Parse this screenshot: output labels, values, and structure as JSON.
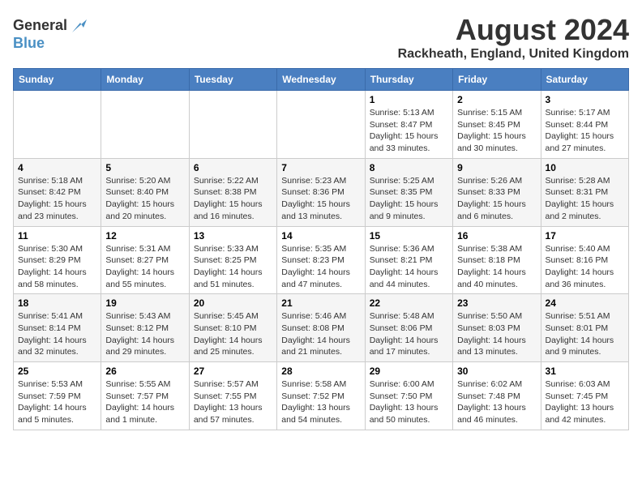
{
  "logo": {
    "line1": "General",
    "line2": "Blue"
  },
  "title": "August 2024",
  "subtitle": "Rackheath, England, United Kingdom",
  "days_header": [
    "Sunday",
    "Monday",
    "Tuesday",
    "Wednesday",
    "Thursday",
    "Friday",
    "Saturday"
  ],
  "weeks": [
    [
      {
        "day": "",
        "info": ""
      },
      {
        "day": "",
        "info": ""
      },
      {
        "day": "",
        "info": ""
      },
      {
        "day": "",
        "info": ""
      },
      {
        "day": "1",
        "info": "Sunrise: 5:13 AM\nSunset: 8:47 PM\nDaylight: 15 hours\nand 33 minutes."
      },
      {
        "day": "2",
        "info": "Sunrise: 5:15 AM\nSunset: 8:45 PM\nDaylight: 15 hours\nand 30 minutes."
      },
      {
        "day": "3",
        "info": "Sunrise: 5:17 AM\nSunset: 8:44 PM\nDaylight: 15 hours\nand 27 minutes."
      }
    ],
    [
      {
        "day": "4",
        "info": "Sunrise: 5:18 AM\nSunset: 8:42 PM\nDaylight: 15 hours\nand 23 minutes."
      },
      {
        "day": "5",
        "info": "Sunrise: 5:20 AM\nSunset: 8:40 PM\nDaylight: 15 hours\nand 20 minutes."
      },
      {
        "day": "6",
        "info": "Sunrise: 5:22 AM\nSunset: 8:38 PM\nDaylight: 15 hours\nand 16 minutes."
      },
      {
        "day": "7",
        "info": "Sunrise: 5:23 AM\nSunset: 8:36 PM\nDaylight: 15 hours\nand 13 minutes."
      },
      {
        "day": "8",
        "info": "Sunrise: 5:25 AM\nSunset: 8:35 PM\nDaylight: 15 hours\nand 9 minutes."
      },
      {
        "day": "9",
        "info": "Sunrise: 5:26 AM\nSunset: 8:33 PM\nDaylight: 15 hours\nand 6 minutes."
      },
      {
        "day": "10",
        "info": "Sunrise: 5:28 AM\nSunset: 8:31 PM\nDaylight: 15 hours\nand 2 minutes."
      }
    ],
    [
      {
        "day": "11",
        "info": "Sunrise: 5:30 AM\nSunset: 8:29 PM\nDaylight: 14 hours\nand 58 minutes."
      },
      {
        "day": "12",
        "info": "Sunrise: 5:31 AM\nSunset: 8:27 PM\nDaylight: 14 hours\nand 55 minutes."
      },
      {
        "day": "13",
        "info": "Sunrise: 5:33 AM\nSunset: 8:25 PM\nDaylight: 14 hours\nand 51 minutes."
      },
      {
        "day": "14",
        "info": "Sunrise: 5:35 AM\nSunset: 8:23 PM\nDaylight: 14 hours\nand 47 minutes."
      },
      {
        "day": "15",
        "info": "Sunrise: 5:36 AM\nSunset: 8:21 PM\nDaylight: 14 hours\nand 44 minutes."
      },
      {
        "day": "16",
        "info": "Sunrise: 5:38 AM\nSunset: 8:18 PM\nDaylight: 14 hours\nand 40 minutes."
      },
      {
        "day": "17",
        "info": "Sunrise: 5:40 AM\nSunset: 8:16 PM\nDaylight: 14 hours\nand 36 minutes."
      }
    ],
    [
      {
        "day": "18",
        "info": "Sunrise: 5:41 AM\nSunset: 8:14 PM\nDaylight: 14 hours\nand 32 minutes."
      },
      {
        "day": "19",
        "info": "Sunrise: 5:43 AM\nSunset: 8:12 PM\nDaylight: 14 hours\nand 29 minutes."
      },
      {
        "day": "20",
        "info": "Sunrise: 5:45 AM\nSunset: 8:10 PM\nDaylight: 14 hours\nand 25 minutes."
      },
      {
        "day": "21",
        "info": "Sunrise: 5:46 AM\nSunset: 8:08 PM\nDaylight: 14 hours\nand 21 minutes."
      },
      {
        "day": "22",
        "info": "Sunrise: 5:48 AM\nSunset: 8:06 PM\nDaylight: 14 hours\nand 17 minutes."
      },
      {
        "day": "23",
        "info": "Sunrise: 5:50 AM\nSunset: 8:03 PM\nDaylight: 14 hours\nand 13 minutes."
      },
      {
        "day": "24",
        "info": "Sunrise: 5:51 AM\nSunset: 8:01 PM\nDaylight: 14 hours\nand 9 minutes."
      }
    ],
    [
      {
        "day": "25",
        "info": "Sunrise: 5:53 AM\nSunset: 7:59 PM\nDaylight: 14 hours\nand 5 minutes."
      },
      {
        "day": "26",
        "info": "Sunrise: 5:55 AM\nSunset: 7:57 PM\nDaylight: 14 hours\nand 1 minute."
      },
      {
        "day": "27",
        "info": "Sunrise: 5:57 AM\nSunset: 7:55 PM\nDaylight: 13 hours\nand 57 minutes."
      },
      {
        "day": "28",
        "info": "Sunrise: 5:58 AM\nSunset: 7:52 PM\nDaylight: 13 hours\nand 54 minutes."
      },
      {
        "day": "29",
        "info": "Sunrise: 6:00 AM\nSunset: 7:50 PM\nDaylight: 13 hours\nand 50 minutes."
      },
      {
        "day": "30",
        "info": "Sunrise: 6:02 AM\nSunset: 7:48 PM\nDaylight: 13 hours\nand 46 minutes."
      },
      {
        "day": "31",
        "info": "Sunrise: 6:03 AM\nSunset: 7:45 PM\nDaylight: 13 hours\nand 42 minutes."
      }
    ]
  ]
}
